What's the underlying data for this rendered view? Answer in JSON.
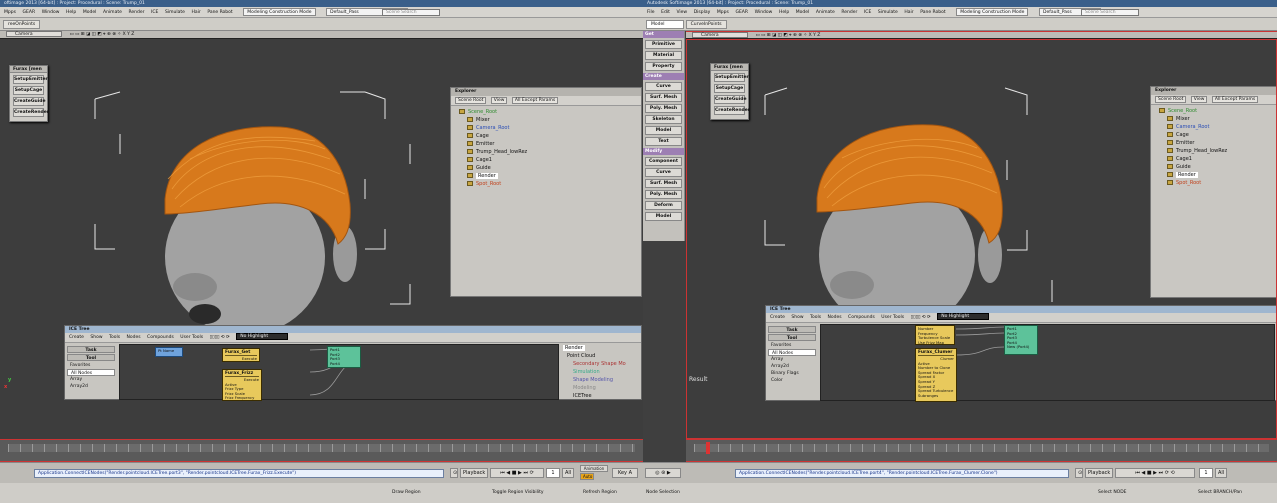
{
  "left": {
    "title": "oftimage 2013 [64-bit] : Project: Procedural : Scene: Trump_01",
    "menu": [
      "Mpps",
      "GEAR",
      "Window",
      "Help",
      "Model",
      "Animate",
      "Render",
      "ICE",
      "Simulate",
      "Hair",
      "Pane Robot"
    ],
    "mode": "Modeling Construction Mode",
    "pass": "Default_Pass",
    "search_placeholder": "Scene Search",
    "toolbar_button": "reeOnPoints",
    "camera": "Camera",
    "float_title": "Furax [men",
    "float_buttons": [
      "SetupEmitter",
      "SetupCage",
      "CreateGuide",
      "CreateRender"
    ],
    "explorer": {
      "title": "Explorer",
      "bar": [
        "Scene Root",
        "View",
        "All Except Params"
      ],
      "items": [
        "Scene_Root",
        "Mixer",
        "Camera_Root",
        "Cage",
        "Emitter",
        "Trump_Head_lowRez",
        "Cage1",
        "Guide",
        "Render",
        "Spot_Root"
      ]
    },
    "ice": {
      "title": "ICE Tree",
      "menu": [
        "Create",
        "Show",
        "Tools",
        "Nodes",
        "Compounds",
        "User Tools"
      ],
      "highlight": "No Highlight",
      "tabs": [
        "Task",
        "Tool"
      ],
      "list": [
        "Favorites",
        "All Nodes",
        "Array",
        "Array2d"
      ],
      "node1": "Furax_Get",
      "node1_port": "Execute",
      "node2": "Furax_Frizz",
      "node2_port": "Execute",
      "node2_params": [
        "Active",
        "Frizz Type",
        "Frizz Scale",
        "Frizz Frequency",
        "Turbulence Scale",
        "Use Frizz Map"
      ],
      "blue_node": "Pt Name",
      "ports": [
        "Port1",
        "Port2",
        "Port3",
        "Port4",
        "New (Port1)"
      ],
      "rtree": [
        "Render",
        "Point Cloud",
        "Secondary Shape Mo",
        "Simulation",
        "Shape Modeling",
        "Modeling",
        "ICETree",
        "Particle Display",
        "Material4"
      ]
    },
    "command": "Application.ConnectICENodes(\"Render.pointcloud.ICETree.port3\", \"Render.pointcloud.ICETree.Furax_Frizz.Execute\")",
    "playback": "Playback",
    "frame_field": "1",
    "all_label": "All",
    "auto_label": "Auto",
    "animation_label": "Animation",
    "keys_label": "Key A",
    "status_items": [
      "Draw Region",
      "Toggle Region Visibility",
      "Refresh Region"
    ],
    "frames": [
      "1",
      "5",
      "10",
      "15",
      "20",
      "25",
      "30",
      "35",
      "40",
      "45",
      "50",
      "55",
      "60",
      "65",
      "70",
      "75",
      "80",
      "85",
      "90",
      "95",
      "100"
    ]
  },
  "right": {
    "title": "Autodesk Softimage 2013 [64-bit] : Project: Procedural : Scene: Trump_01",
    "menu": [
      "File",
      "Edit",
      "View",
      "Display",
      "Mpps",
      "GEAR",
      "Window",
      "Help",
      "Model",
      "Animate",
      "Render",
      "ICE",
      "Simulate",
      "Hair",
      "Pane Robot"
    ],
    "mode": "Modeling Construction Mode",
    "pass": "Default_Pass",
    "search_placeholder": "Scene Search",
    "model_dropdown": "Model",
    "toolbar_button": "CurveInPoints",
    "camera": "Camera",
    "side_get": "Get",
    "side_get_items": [
      "Primitive",
      "Material",
      "Property"
    ],
    "side_create": "Create",
    "side_create_items": [
      "Curve",
      "Surf. Mesh",
      "Poly. Mesh",
      "Skeleton",
      "Model",
      "Text"
    ],
    "side_modify": "Modify",
    "side_modify_items": [
      "Component",
      "Curve",
      "Surf. Mesh",
      "Poly. Mesh",
      "Deform",
      "Model"
    ],
    "float_title": "Furax [men",
    "float_buttons": [
      "SetupEmitter",
      "SetupCage",
      "CreateGuide",
      "CreateRender"
    ],
    "explorer": {
      "title": "Explorer",
      "bar": [
        "Scene Root",
        "View",
        "All Except Params"
      ],
      "items": [
        "Scene_Root",
        "Mixer",
        "Camera_Root",
        "Cage",
        "Emitter",
        "Trump_Head_lowRez",
        "Cage1",
        "Guide",
        "Render",
        "Spot_Root"
      ]
    },
    "ice": {
      "title": "ICE Tree",
      "menu": [
        "Create",
        "Show",
        "Tools",
        "Nodes",
        "Compounds",
        "User Tools"
      ],
      "highlight": "No Highlight",
      "tabs": [
        "Task",
        "Tool"
      ],
      "list": [
        "Favorites",
        "All Nodes",
        "Array",
        "Array2d",
        "Binary Flags",
        "Color"
      ],
      "node1": "Furax_Clumer",
      "node1_port": "Clumer",
      "node_params": [
        "Active",
        "Number to Clone",
        "Spread Factor",
        "Spread X",
        "Spread Y",
        "Spread Z",
        "Spread Turbulence",
        "Subranges",
        "Turbulence Frequency",
        "Turbulence Scale",
        "Turbulence Res"
      ],
      "top_params": [
        "Number Frequency",
        "Turbulence Scale",
        "Use Frizz Map"
      ],
      "ports": [
        "Port1",
        "Port2",
        "Port3",
        "Port4",
        "New (Port4)"
      ]
    },
    "result_label": "Result",
    "command": "Application.ConnectICENodes(\"Render.pointcloud.ICETree.port4\", \"Render.pointcloud.ICETree.Furax_Clumer.Clone\")",
    "playback": "Playback",
    "frame_field": "1",
    "all_label": "All",
    "status_items": [
      "Node Selection",
      "Select NODE",
      "Select BRANCH/Pan"
    ]
  }
}
